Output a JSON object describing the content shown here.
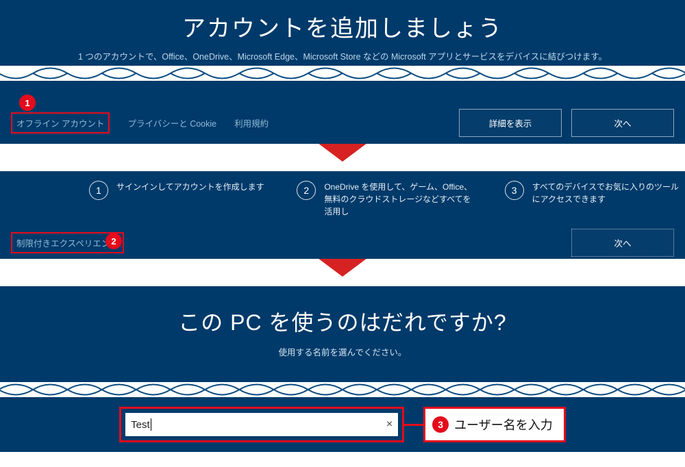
{
  "panel1": {
    "title": "アカウントを追加しましょう",
    "subtitle": "1 つのアカウントで、Office、OneDrive、Microsoft Edge、Microsoft Store などの Microsoft アプリとサービスをデバイスに結びつけます。",
    "links": {
      "offline": "オフライン アカウント",
      "privacy": "プライバシーと Cookie",
      "terms": "利用規約"
    },
    "buttons": {
      "details": "詳細を表示",
      "next": "次へ"
    },
    "callout": "1"
  },
  "panel2": {
    "benefits": [
      {
        "num": "1",
        "text": "サインインしてアカウントを作成します"
      },
      {
        "num": "2",
        "text": "OneDrive を使用して、ゲーム、Office、無料のクラウドストレージなどすべてを活用し"
      },
      {
        "num": "3",
        "text": "すべてのデバイスでお気に入りのツールにアクセスできます"
      }
    ],
    "limited_link": "制限付きエクスペリエンス",
    "next": "次へ",
    "callout": "2"
  },
  "panel3": {
    "title": "この PC を使うのはだれですか?",
    "subtitle": "使用する名前を選んでください。",
    "input_value": "Test",
    "clear_glyph": "×",
    "caption_num": "3",
    "caption_text": "ユーザー名を入力"
  }
}
